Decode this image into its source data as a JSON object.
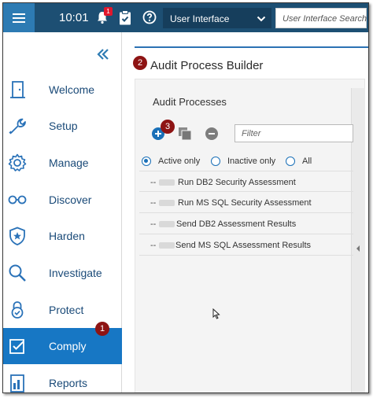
{
  "topbar": {
    "time": "10:01",
    "notification_count": "1",
    "app_selector_value": "User Interface",
    "search_placeholder": "User Interface Search",
    "icons": [
      "menu-icon",
      "bell-icon",
      "clipboard-icon",
      "help-icon",
      "chevron-down-icon"
    ],
    "colors": {
      "bar": "#1d4f73",
      "hamburger": "#2d7bb3"
    }
  },
  "sidebar": {
    "collapse_icon": "double-chevron-left-icon",
    "items": [
      {
        "label": "Welcome",
        "icon": "door-icon"
      },
      {
        "label": "Setup",
        "icon": "wrench-icon"
      },
      {
        "label": "Manage",
        "icon": "gear-icon"
      },
      {
        "label": "Discover",
        "icon": "glasses-icon"
      },
      {
        "label": "Harden",
        "icon": "shield-star-icon"
      },
      {
        "label": "Investigate",
        "icon": "magnifier-icon"
      },
      {
        "label": "Protect",
        "icon": "lock-icon"
      },
      {
        "label": "Comply",
        "icon": "checkbox-icon",
        "active": true
      },
      {
        "label": "Reports",
        "icon": "report-icon"
      }
    ],
    "active_color": "#1777c4"
  },
  "callouts": {
    "one": "1",
    "two": "2",
    "three": "3"
  },
  "main": {
    "title": "Audit Process Builder",
    "section_title": "Audit Processes",
    "filter_placeholder": "Filter",
    "toolbar_icons": [
      "add-icon",
      "copy-icon",
      "remove-icon"
    ],
    "radios": [
      {
        "label": "Active only",
        "selected": true
      },
      {
        "label": "Inactive only",
        "selected": false
      },
      {
        "label": "All",
        "selected": false
      }
    ],
    "prefix": "--",
    "processes": [
      "Run DB2 Security Assessment",
      "Run MS SQL Security Assessment",
      "Send DB2 Assessment Results",
      "Send MS SQL Assessment Results"
    ]
  }
}
